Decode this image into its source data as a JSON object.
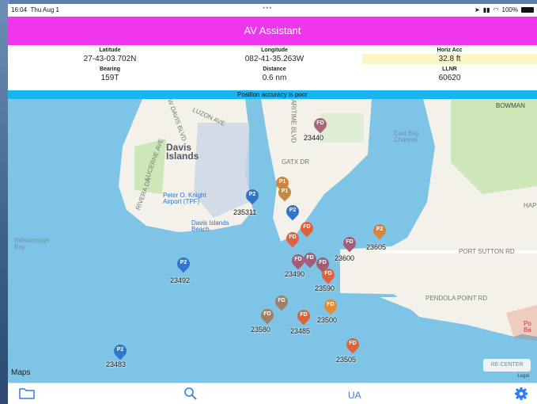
{
  "status": {
    "time": "16:04",
    "date": "Thu Aug 1",
    "battery": "100%",
    "dots": "•••"
  },
  "app_title": "AV Assistant",
  "info": {
    "latitude_label": "Latitude",
    "latitude_value": "27-43-03.702N",
    "longitude_label": "Longitude",
    "longitude_value": "082-41-35.263W",
    "horiz_label": "Horiz Acc",
    "horiz_value": "32.8 ft",
    "bearing_label": "Bearing",
    "bearing_value": "159T",
    "distance_label": "Distance",
    "distance_value": "0.6 nm",
    "llnr_label": "LLNR",
    "llnr_value": "60620"
  },
  "alert": "Position accuracy is poor",
  "map_labels": {
    "davis_islands": "Davis\nIslands",
    "airport": "Peter O. Knight\nAirport (TPF)",
    "beach": "Davis Islands\nBeach",
    "hillsborough": "Hillsborough\nBay",
    "eastbay": "East Bay\nChannel",
    "luzon": "LUZON AVE",
    "port_sutton": "PORT SUTTON RD",
    "pendola": "PENDOLA POINT RD",
    "gatx": "GATX DR",
    "bowman": "BOWMAN",
    "rivera": "RIVERA DR",
    "lucerne": "LUCERNE AVE",
    "wdavis": "W DAVIS BLVD",
    "maritime": "MARITIME BLVD",
    "hap": "HAP",
    "po": "Po\nBa"
  },
  "pins": [
    {
      "label": "FD",
      "color": "#a8687a"
    },
    {
      "label": "P1",
      "color": "#d9823a"
    },
    {
      "label": "P1",
      "color": "#c8893e"
    },
    {
      "label": "P2",
      "color": "#2f76cc"
    },
    {
      "label": "P2",
      "color": "#2f76cc"
    },
    {
      "label": "FD",
      "color": "#e0623a"
    },
    {
      "label": "FD",
      "color": "#e0623a"
    },
    {
      "label": "FD",
      "color": "#a25e78"
    },
    {
      "label": "P2",
      "color": "#d9823a"
    },
    {
      "label": "FD",
      "color": "#a25e78"
    },
    {
      "label": "FD",
      "color": "#a25e78"
    },
    {
      "label": "FD",
      "color": "#a25e78"
    },
    {
      "label": "FD",
      "color": "#e0623a"
    },
    {
      "label": "P2",
      "color": "#2f76cc"
    },
    {
      "label": "FD",
      "color": "#a08060"
    },
    {
      "label": "FD",
      "color": "#a08060"
    },
    {
      "label": "FD",
      "color": "#e0623a"
    },
    {
      "label": "FD",
      "color": "#e58a30"
    },
    {
      "label": "FD",
      "color": "#e0623a"
    },
    {
      "label": "P2",
      "color": "#2f76cc"
    }
  ],
  "tags": [
    "23440",
    "235311",
    "23605",
    "23600",
    "23492",
    "23490",
    "23590",
    "23580",
    "23485",
    "23500",
    "23505",
    "23483"
  ],
  "recenter": "RE-CENTER",
  "maps_brand": "Maps",
  "legal": "Legal",
  "toolbar": {
    "ua_label": "UA"
  }
}
